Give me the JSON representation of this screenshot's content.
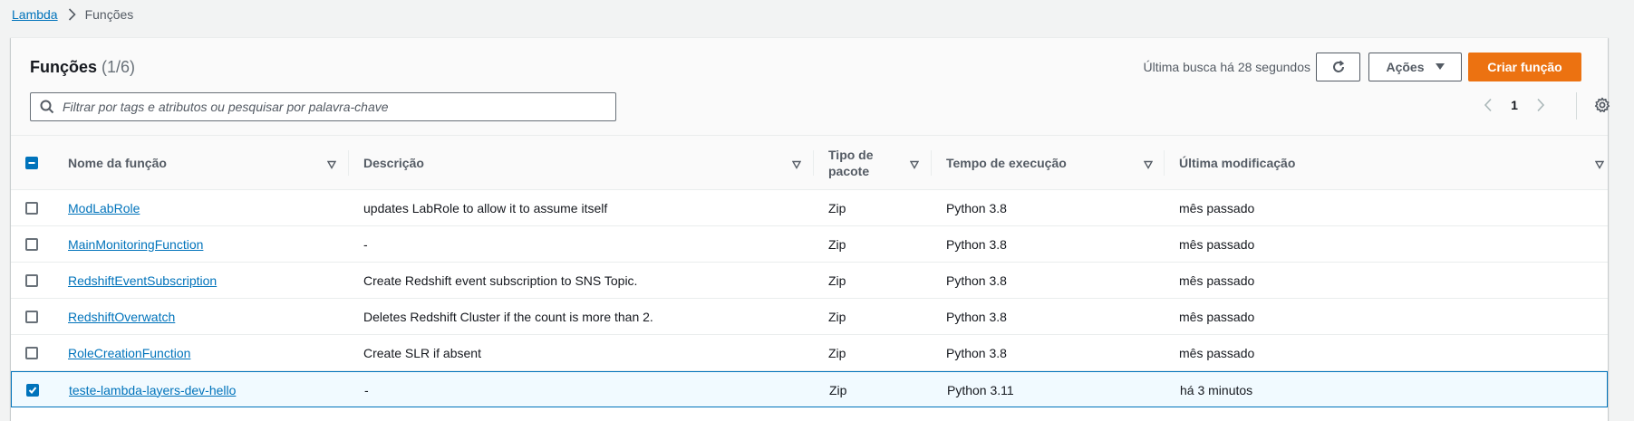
{
  "breadcrumb": {
    "root": "Lambda",
    "current": "Funções"
  },
  "panel": {
    "title": "Funções",
    "count": "(1/6)",
    "last_fetch": "Última busca há 28 segundos",
    "actions_label": "Ações",
    "create_label": "Criar função",
    "search_placeholder": "Filtrar por tags e atributos ou pesquisar por palavra-chave",
    "page_number": "1"
  },
  "table": {
    "headers": {
      "name": "Nome da função",
      "description": "Descrição",
      "package_line1": "Tipo de",
      "package_line2": "pacote",
      "runtime": "Tempo de execução",
      "modified": "Última modificação"
    },
    "rows": [
      {
        "name": "ModLabRole",
        "description": "updates LabRole to allow it to assume itself",
        "package": "Zip",
        "runtime": "Python 3.8",
        "modified": "mês passado",
        "selected": false
      },
      {
        "name": "MainMonitoringFunction",
        "description": "-",
        "package": "Zip",
        "runtime": "Python 3.8",
        "modified": "mês passado",
        "selected": false
      },
      {
        "name": "RedshiftEventSubscription",
        "description": "Create Redshift event subscription to SNS Topic.",
        "package": "Zip",
        "runtime": "Python 3.8",
        "modified": "mês passado",
        "selected": false
      },
      {
        "name": "RedshiftOverwatch",
        "description": "Deletes Redshift Cluster if the count is more than 2.",
        "package": "Zip",
        "runtime": "Python 3.8",
        "modified": "mês passado",
        "selected": false
      },
      {
        "name": "RoleCreationFunction",
        "description": "Create SLR if absent",
        "package": "Zip",
        "runtime": "Python 3.8",
        "modified": "mês passado",
        "selected": false
      },
      {
        "name": "teste-lambda-layers-dev-hello",
        "description": "-",
        "package": "Zip",
        "runtime": "Python 3.11",
        "modified": "há 3 minutos",
        "selected": true
      }
    ]
  },
  "colors": {
    "accent": "#0073bb",
    "primary_button": "#ec7211",
    "selected_row_bg": "#f1faff"
  }
}
